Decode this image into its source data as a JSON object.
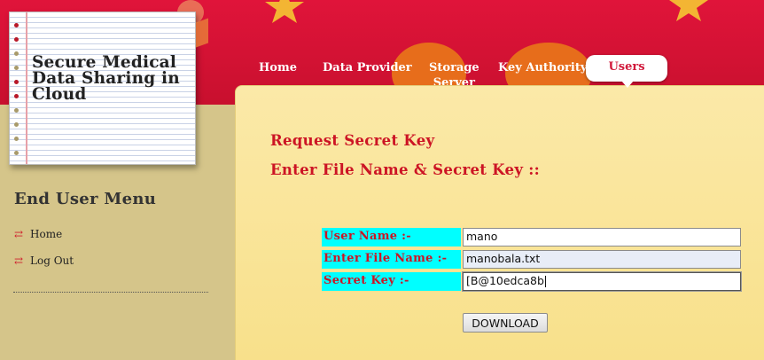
{
  "site": {
    "title": "Secure Medical Data Sharing in Cloud"
  },
  "nav": {
    "home": "Home",
    "data_provider": "Data Provider",
    "storage_server_line1": "Storage",
    "storage_server_line2": "Server",
    "key_authority": "Key Authority",
    "users": "Users"
  },
  "sidebar": {
    "title": "End User Menu",
    "items": [
      {
        "label": "Home",
        "icon": "arrow-icon"
      },
      {
        "label": "Log Out",
        "icon": "arrow-icon"
      }
    ]
  },
  "main": {
    "heading1": "Request Secret Key",
    "heading2": "Enter File Name & Secret Key ::",
    "form": {
      "username_label": "User Name :-",
      "username_value": "mano",
      "filename_label": "Enter File Name :-",
      "filename_value": "manobala.txt",
      "secretkey_label": "Secret Key :-",
      "secretkey_value": "[B@10edca8b",
      "download_label": "DOWNLOAD"
    }
  },
  "colors": {
    "header": "#d8143a",
    "accent_red": "#cc1424",
    "label_bg": "#00ffff",
    "panel_bg": "#f9e394"
  }
}
